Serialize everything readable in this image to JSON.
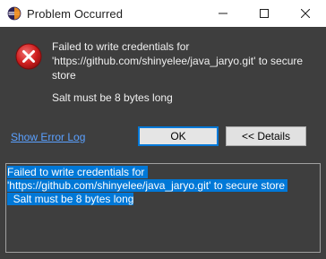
{
  "window": {
    "title": "Problem Occurred",
    "controls": [
      "minimize",
      "maximize",
      "close"
    ]
  },
  "dialog": {
    "icon": "error-icon",
    "message_line1": "Failed to write credentials for",
    "message_line2": "'https://github.com/shinyelee/java_jaryo.git' to secure",
    "message_line3": "store",
    "detail_reason": "Salt must be 8 bytes long",
    "show_error_log_label": "Show Error Log",
    "ok_label": "OK",
    "details_label": "<< Details"
  },
  "details": {
    "line1": "Failed to write credentials for ",
    "line2": "'https://github.com/shinyelee/java_jaryo.git' to secure store ",
    "line3": "  Salt must be 8 bytes long"
  },
  "colors": {
    "background": "#3e3e3e",
    "selection": "#0078d7",
    "link": "#5aa0ff"
  }
}
